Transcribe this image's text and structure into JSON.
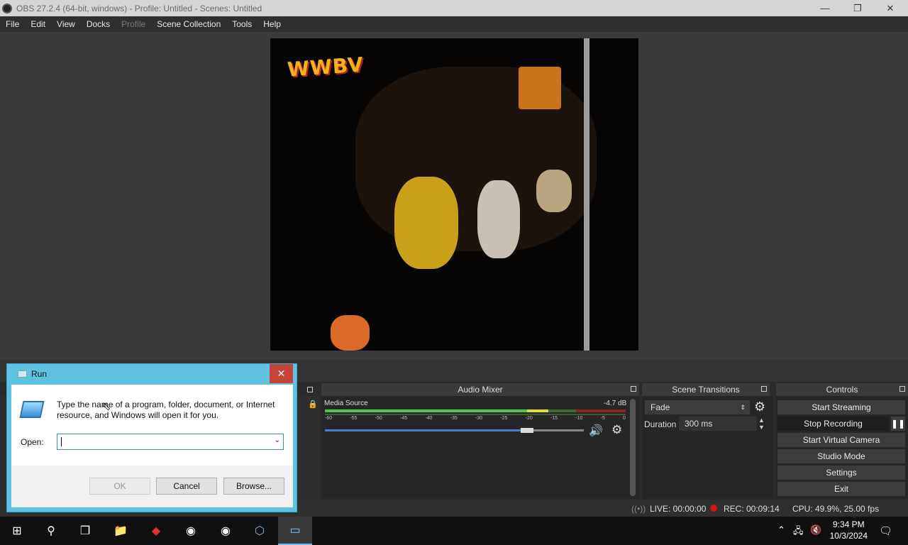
{
  "window": {
    "title": "OBS 27.2.4 (64-bit, windows) - Profile: Untitled - Scenes: Untitled"
  },
  "menu": [
    "File",
    "Edit",
    "View",
    "Docks",
    "Profile",
    "Scene Collection",
    "Tools",
    "Help"
  ],
  "preview": {
    "overlay_logo": "WWBV"
  },
  "docks": {
    "audio_mixer": "Audio Mixer",
    "scene_transitions": "Scene Transitions",
    "controls": "Controls"
  },
  "mixer": {
    "source_name": "Media Source",
    "db_readout": "-4.7 dB",
    "ticks": [
      "-60",
      "-55",
      "-50",
      "-45",
      "-40",
      "-35",
      "-30",
      "-25",
      "-20",
      "-15",
      "-10",
      "-5",
      "0"
    ],
    "volume_fraction": 0.76
  },
  "transitions": {
    "selected": "Fade",
    "duration_label": "Duration",
    "duration_value": "300 ms"
  },
  "controls": {
    "start_streaming": "Start Streaming",
    "stop_recording": "Stop Recording",
    "start_virtual_camera": "Start Virtual Camera",
    "studio_mode": "Studio Mode",
    "settings": "Settings",
    "exit": "Exit"
  },
  "status": {
    "live": "LIVE: 00:00:00",
    "rec": "REC: 00:09:14",
    "cpu": "CPU: 49.9%, 25.00 fps"
  },
  "run_dialog": {
    "title": "Run",
    "prompt": "Type the name of a program, folder, document, or Internet resource, and Windows will open it for you.",
    "open_label": "Open:",
    "open_value": "",
    "ok": "OK",
    "cancel": "Cancel",
    "browse": "Browse..."
  },
  "taskbar": {
    "time": "9:34 PM",
    "date": "10/3/2024"
  },
  "colors": {
    "rec_red": "#d31616",
    "accent_blue": "#4a7bd0",
    "run_border": "#5fc2e3"
  }
}
